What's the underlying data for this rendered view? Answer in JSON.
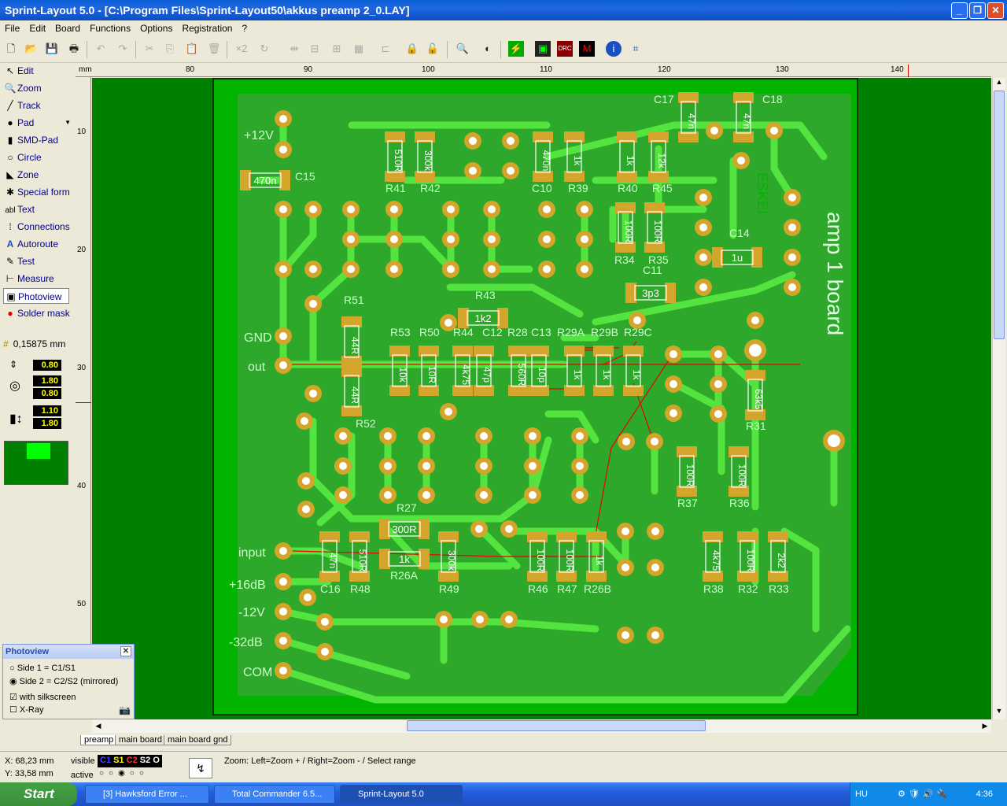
{
  "window": {
    "title": "Sprint-Layout 5.0 - [C:\\Program Files\\Sprint-Layout50\\akkus preamp 2_0.LAY]"
  },
  "menu": [
    "File",
    "Edit",
    "Board",
    "Functions",
    "Options",
    "Registration",
    "?"
  ],
  "toolbar": {
    "icons": [
      "new-icon",
      "open-icon",
      "save-icon",
      "print-icon",
      "undo-icon",
      "redo-icon",
      "cut-icon",
      "copy-icon",
      "paste-icon",
      "delete-icon",
      "x2-icon",
      "rotate-icon",
      "mirror-icon",
      "align-icon",
      "group-icon",
      "ungroup-icon",
      "lock-icon",
      "unlock-icon",
      "zoom-icon",
      "layer-icon",
      "drc-icon",
      "macro-icon",
      "info-icon",
      "crop-icon"
    ],
    "x2": "×2"
  },
  "tools": [
    {
      "icon": "↖",
      "label": "Edit"
    },
    {
      "icon": "🔍",
      "label": "Zoom"
    },
    {
      "icon": "╱",
      "label": "Track"
    },
    {
      "icon": "●",
      "label": "Pad"
    },
    {
      "icon": "▮",
      "label": "SMD-Pad"
    },
    {
      "icon": "○",
      "label": "Circle"
    },
    {
      "icon": "◣",
      "label": "Zone"
    },
    {
      "icon": "✱",
      "label": "Special form"
    },
    {
      "icon": "abl",
      "label": "Text"
    },
    {
      "icon": "⁞",
      "label": "Connections"
    },
    {
      "icon": "A",
      "label": "Autoroute"
    },
    {
      "icon": "✎",
      "label": "Test"
    },
    {
      "icon": "⊢",
      "label": "Measure"
    },
    {
      "icon": "▣",
      "label": "Photoview"
    },
    {
      "icon": "●",
      "label": "Solder mask"
    }
  ],
  "grid": "0,15875 mm",
  "values": {
    "track": "0.80",
    "pad_outer": "1.80",
    "pad_inner": "0.80",
    "smd_w": "1.10",
    "smd_h": "1.80"
  },
  "ruler": {
    "unit": "mm",
    "top": [
      "80",
      "90",
      "100",
      "110",
      "120",
      "130",
      "140"
    ],
    "left": [
      "10",
      "20",
      "30",
      "40",
      "50"
    ]
  },
  "pcb": {
    "board_text": "amp 1 board",
    "signature": "ESKEI",
    "pin_labels": [
      "+12V",
      "GND",
      "out",
      "input",
      "+16dB",
      "-12V",
      "-32dB",
      "COM"
    ],
    "parts": [
      {
        "ref": "R41",
        "val": "510R"
      },
      {
        "ref": "R42",
        "val": "300k"
      },
      {
        "ref": "C10",
        "val": "470n"
      },
      {
        "ref": "R39",
        "val": "1k"
      },
      {
        "ref": "R40",
        "val": "1k"
      },
      {
        "ref": "R45",
        "val": "12k"
      },
      {
        "ref": "C17",
        "val": "47n"
      },
      {
        "ref": "C18",
        "val": "47n"
      },
      {
        "ref": "C15",
        "val": "470n"
      },
      {
        "ref": "R34",
        "val": "100R"
      },
      {
        "ref": "R35",
        "val": "100R"
      },
      {
        "ref": "C14",
        "val": "1u"
      },
      {
        "ref": "C11",
        "val": "3p3"
      },
      {
        "ref": "R43",
        "val": "1k2"
      },
      {
        "ref": "R51",
        "val": "44R"
      },
      {
        "ref": "R52",
        "val": "44R"
      },
      {
        "ref": "R53",
        "val": "10k"
      },
      {
        "ref": "R50",
        "val": "10R"
      },
      {
        "ref": "R44",
        "val": "4k75"
      },
      {
        "ref": "C12",
        "val": "47p"
      },
      {
        "ref": "R28",
        "val": "560R"
      },
      {
        "ref": "C13",
        "val": "10p"
      },
      {
        "ref": "R29A",
        "val": "1k"
      },
      {
        "ref": "R29B",
        "val": "1k"
      },
      {
        "ref": "R29C",
        "val": "1k"
      },
      {
        "ref": "R31",
        "val": "63k5"
      },
      {
        "ref": "R37",
        "val": "100R"
      },
      {
        "ref": "R36",
        "val": "100R"
      },
      {
        "ref": "R27",
        "val": "300R"
      },
      {
        "ref": "R26A",
        "val": "1k"
      },
      {
        "ref": "C16",
        "val": "47n"
      },
      {
        "ref": "R48",
        "val": "510R"
      },
      {
        "ref": "R49",
        "val": "300k"
      },
      {
        "ref": "R46",
        "val": "100R"
      },
      {
        "ref": "R47",
        "val": "100R"
      },
      {
        "ref": "R26B",
        "val": "1k"
      },
      {
        "ref": "R38",
        "val": "4k75"
      },
      {
        "ref": "R32",
        "val": "100R"
      },
      {
        "ref": "R33",
        "val": "2k2"
      }
    ]
  },
  "tabs": [
    "preamp",
    "main board",
    "main board gnd"
  ],
  "photoview": {
    "title": "Photoview",
    "side1": "Side 1 = C1/S1",
    "side2": "Side 2 = C2/S2 (mirrored)",
    "silk": "with silkscreen",
    "xray": "X-Ray"
  },
  "status": {
    "x": "X:  68,23 mm",
    "y": "Y:  33,58 mm",
    "visible": "visible",
    "active": "active",
    "layers": [
      "C1",
      "S1",
      "C2",
      "S2",
      "O"
    ],
    "hint": "Zoom: Left=Zoom + / Right=Zoom - / Select range"
  },
  "taskbar": {
    "start": "Start",
    "tasks": [
      "[3] Hawksford Error ...",
      "Total Commander 6.5...",
      "Sprint-Layout 5.0"
    ],
    "lang": "HU",
    "time": "4:36"
  },
  "colors": {
    "board": "#00b400",
    "copper": "#4bd93a",
    "pad": "#d3a52a",
    "outside": "#008000"
  }
}
